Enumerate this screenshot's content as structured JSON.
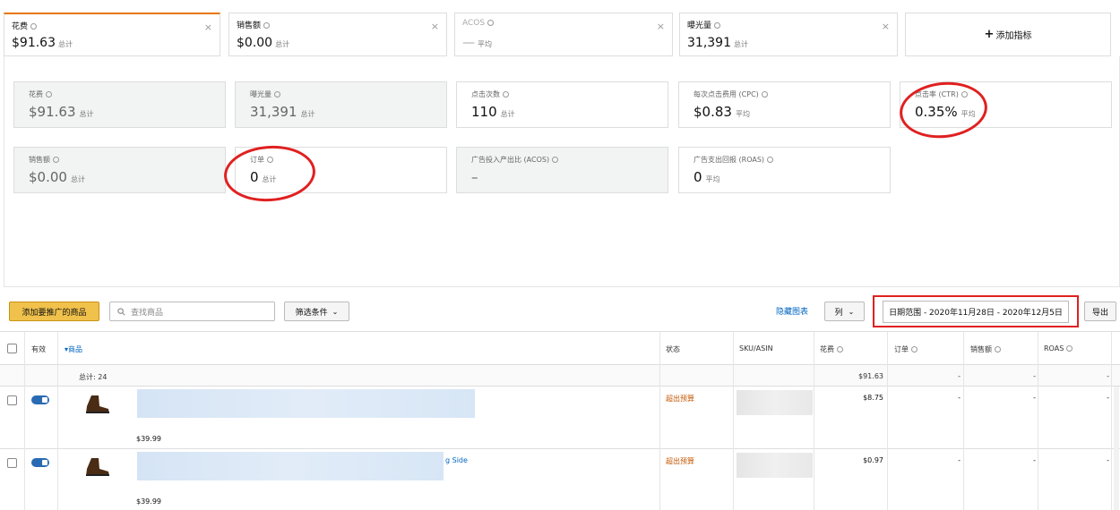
{
  "top_tabs": [
    {
      "label": "花费",
      "value": "$91.63",
      "unit": "总计"
    },
    {
      "label": "销售额",
      "value": "$0.00",
      "unit": "总计"
    },
    {
      "label": "ACOS",
      "value": "—",
      "unit": "平均"
    },
    {
      "label": "曝光量",
      "value": "31,391",
      "unit": "总计"
    }
  ],
  "add_metric": {
    "plus": "+",
    "label": "添加指标"
  },
  "cards": [
    {
      "label": "花费",
      "value": "$91.63",
      "unit": "总计"
    },
    {
      "label": "曝光量",
      "value": "31,391",
      "unit": "总计"
    },
    {
      "label": "点击次数",
      "value": "110",
      "unit": "总计"
    },
    {
      "label": "每次点击费用 (CPC)",
      "value": "$0.83",
      "unit": "平均"
    },
    {
      "label": "点击率 (CTR)",
      "value": "0.35%",
      "unit": "平均"
    },
    {
      "label": "销售额",
      "value": "$0.00",
      "unit": "总计"
    },
    {
      "label": "订单",
      "value": "0",
      "unit": "总计"
    },
    {
      "label": "广告投入产出比 (ACOS)",
      "value": "–",
      "unit": ""
    },
    {
      "label": "广告支出回报 (ROAS)",
      "value": "0",
      "unit": "平均"
    }
  ],
  "toolbar": {
    "add_button": "添加要推广的商品",
    "search_placeholder": "查找商品",
    "filter": "筛选条件",
    "hide_chart": "隐藏图表",
    "columns": "列",
    "date_range": "日期范围 - 2020年11月28日 - 2020年12月5日",
    "export": "导出"
  },
  "table": {
    "headers": {
      "active": "有效",
      "product": "▾商品",
      "status": "状态",
      "sku": "SKU/ASIN",
      "spend": "花费",
      "orders": "订单",
      "sales": "销售额",
      "roas": "ROAS"
    },
    "total_label": "总计: 24",
    "total_spend": "$91.63",
    "total_orders": "-",
    "total_sales": "-",
    "total_roas": "-",
    "rows": [
      {
        "price": "$39.99",
        "title_tail": "",
        "status": "超出预算",
        "spend": "$8.75",
        "orders": "-",
        "sales": "-",
        "roas": "-"
      },
      {
        "price": "$39.99",
        "title_tail": "g Side",
        "status": "超出预算",
        "spend": "$0.97",
        "orders": "-",
        "sales": "-",
        "roas": "-"
      }
    ]
  },
  "colors": {
    "accent": "#f0c14b",
    "link": "#0066c0",
    "status": "#c45500",
    "highlight": "#e02020"
  }
}
